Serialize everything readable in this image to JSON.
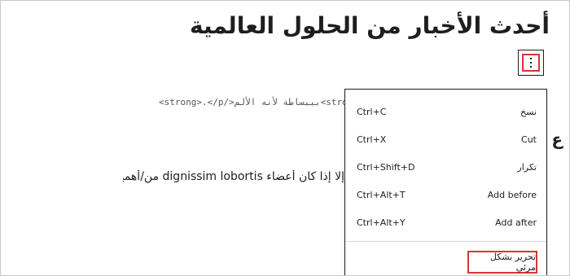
{
  "post": {
    "title": "أحدث الأخبار من الحلول العالمية",
    "code_line": "<strong>.</p/>بببساطة لأنه الألم<strong>",
    "paragraph": "إلا إذا كان أعضاء dignissim lobortis من/أهمية السيارة."
  },
  "toolbar": {
    "more_options_icon": "vertical-ellipsis-icon",
    "highlight_color": "#d63638"
  },
  "menu": {
    "items": [
      {
        "label": "نسخ",
        "shortcut": "Ctrl+C"
      },
      {
        "label": "Cut",
        "shortcut": "Ctrl+X"
      },
      {
        "label": "تكرار",
        "shortcut": "Ctrl+Shift+D"
      },
      {
        "label": "Add before",
        "shortcut": "Ctrl+Alt+T"
      },
      {
        "label": "Add after",
        "shortcut": "Ctrl+Alt+Y"
      }
    ],
    "visual_edit_label": "تحرير بشكل مرئي"
  }
}
